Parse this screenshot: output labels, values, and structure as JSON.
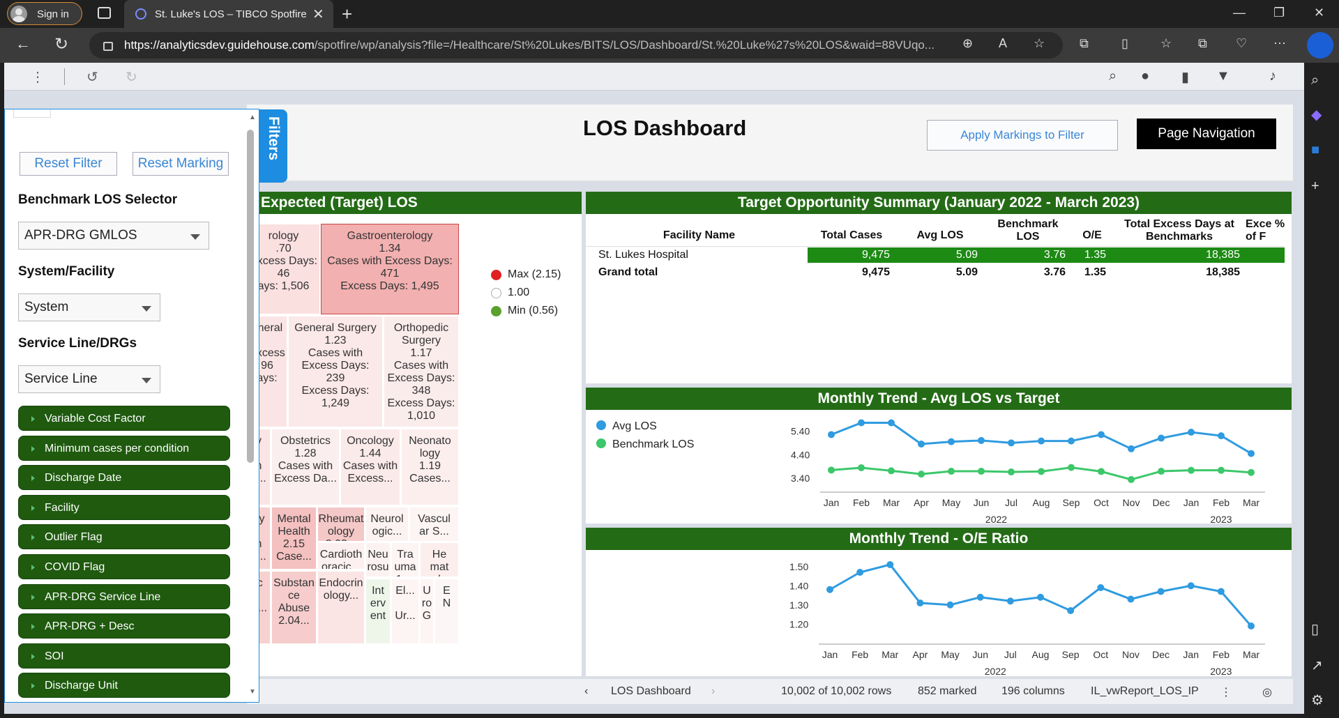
{
  "browser": {
    "signin_label": "Sign in",
    "tab_title": "St. Luke's LOS – TIBCO Spotfire",
    "url_host": "https://analyticsdev.guidehouse.com",
    "url_path": "/spotfire/wp/analysis?file=/Healthcare/St%20Lukes/BITS/LOS/Dashboard/St.%20Luke%27s%20LOS&waid=88VUqo..."
  },
  "dashboard": {
    "title": "LOS Dashboard",
    "apply_markings": "Apply Markings to Filter",
    "page_navigation": "Page Navigation"
  },
  "filters": {
    "tab_label": "Filters",
    "reset_filter": "Reset Filter",
    "reset_marking": "Reset Marking",
    "benchmark_label": "Benchmark LOS Selector",
    "benchmark_value": "APR-DRG GMLOS",
    "system_label": "System/Facility",
    "system_value": "System",
    "service_label": "Service Line/DRGs",
    "service_value": "Service Line",
    "facets": [
      "Variable Cost Factor",
      "Minimum cases per condition",
      "Discharge Date",
      "Facility",
      "Outlier Flag",
      "COVID Flag",
      "APR-DRG Service Line",
      "APR-DRG + Desc",
      "SOI",
      "Discharge Unit"
    ]
  },
  "treemap": {
    "title": "Expected (Target) LOS",
    "legend_max": "Max (2.15)",
    "legend_mid": "1.00",
    "legend_min": "Min (0.56)",
    "colors": {
      "max": "#e02020",
      "min": "#5aa02c"
    },
    "cells": [
      "rology\n.70\nExcess Days:\n46\nays: 1,506",
      "Gastroenterology\n1.34\nCases with Excess Days:\n471\nExcess Days: 1,495",
      "eneral\n\nExcess\n96\nays:",
      "General Surgery\n1.23\nCases with\nExcess Days:\n239\nExcess Days:\n1,249",
      "Orthopedic\nSurgery\n1.17\nCases with\nExcess Days:\n348\nExcess Days:\n1,010",
      "y\n\nh\ns...",
      "Obstetrics\n1.28\nCases with\nExcess Da...",
      "Oncology\n1.44\nCases with\nExcess...",
      "Neonato\nlogy\n1.19\nCases...",
      "gy\n\nh\ns...",
      "Mental\nHealth\n2.15\nCase...",
      "Rheumat\nology\n2.03...",
      "Neurol\nogic...",
      "Vascul\nar S...",
      "Cardioth\noracic...",
      "Neu\nrosu\nrg...",
      "Tra\numa\n1....",
      "He\nmat\nolo",
      "ic\n\nE...",
      "Substan\nce\nAbuse\n2.04...",
      "Endocrin\nology...",
      "Int\nerv\nent",
      "El...\n\nUr...",
      "U\nro\nG",
      "E\nN\n"
    ]
  },
  "summary": {
    "title": "Target Opportunity Summary (January 2022 - March 2023)",
    "columns": [
      "Facility Name",
      "Total Cases",
      "Avg LOS",
      "Benchmark LOS",
      "O/E",
      "Total Excess Days at Benchmarks",
      "Exce % of F"
    ],
    "rows": [
      {
        "name": "St. Lukes Hospital",
        "cases": "9,475",
        "avg": "5.09",
        "bench": "3.76",
        "oe": "1.35",
        "excess": "18,385"
      },
      {
        "name": "Grand total",
        "cases": "9,475",
        "avg": "5.09",
        "bench": "3.76",
        "oe": "1.35",
        "excess": "18,385"
      }
    ]
  },
  "chart_data": [
    {
      "type": "line",
      "title": "Monthly Trend - Avg LOS vs Target",
      "x": [
        "Jan",
        "Feb",
        "Mar",
        "Apr",
        "May",
        "Jun",
        "Jul",
        "Aug",
        "Sep",
        "Oct",
        "Nov",
        "Dec",
        "Jan",
        "Feb",
        "Mar"
      ],
      "x_groups": [
        {
          "label": "2022",
          "count": 12
        },
        {
          "label": "2023",
          "count": 3
        }
      ],
      "series": [
        {
          "name": "Avg LOS",
          "color": "#2f9be0",
          "values": [
            5.25,
            5.75,
            5.75,
            4.85,
            4.95,
            5.0,
            4.9,
            4.98,
            4.98,
            5.25,
            4.65,
            5.1,
            5.35,
            5.2,
            4.45
          ]
        },
        {
          "name": "Benchmark LOS",
          "color": "#3cc76a",
          "values": [
            3.75,
            3.85,
            3.72,
            3.58,
            3.7,
            3.7,
            3.67,
            3.69,
            3.86,
            3.69,
            3.35,
            3.7,
            3.74,
            3.74,
            3.65
          ]
        }
      ],
      "yticks": [
        "5.40",
        "4.40",
        "3.40"
      ],
      "ylim": [
        3.2,
        6.0
      ],
      "legend": "top-left"
    },
    {
      "type": "line",
      "title": "Monthly Trend - O/E Ratio",
      "x": [
        "Jan",
        "Feb",
        "Mar",
        "Apr",
        "May",
        "Jun",
        "Jul",
        "Aug",
        "Sep",
        "Oct",
        "Nov",
        "Dec",
        "Jan",
        "Feb",
        "Mar"
      ],
      "x_groups": [
        {
          "label": "2022",
          "count": 12
        },
        {
          "label": "2023",
          "count": 3
        }
      ],
      "series": [
        {
          "name": "",
          "color": "#2f9be0",
          "values": [
            1.38,
            1.47,
            1.51,
            1.31,
            1.3,
            1.34,
            1.32,
            1.34,
            1.27,
            1.39,
            1.33,
            1.37,
            1.4,
            1.37,
            1.19
          ]
        }
      ],
      "yticks": [
        "1.50",
        "1.40",
        "1.30",
        "1.20"
      ],
      "ylim": [
        1.15,
        1.55
      ]
    }
  ],
  "status": {
    "page": "LOS Dashboard",
    "rows": "10,002 of 10,002 rows",
    "marked": "852 marked",
    "columns": "196 columns",
    "table": "IL_vwReport_LOS_IP"
  }
}
